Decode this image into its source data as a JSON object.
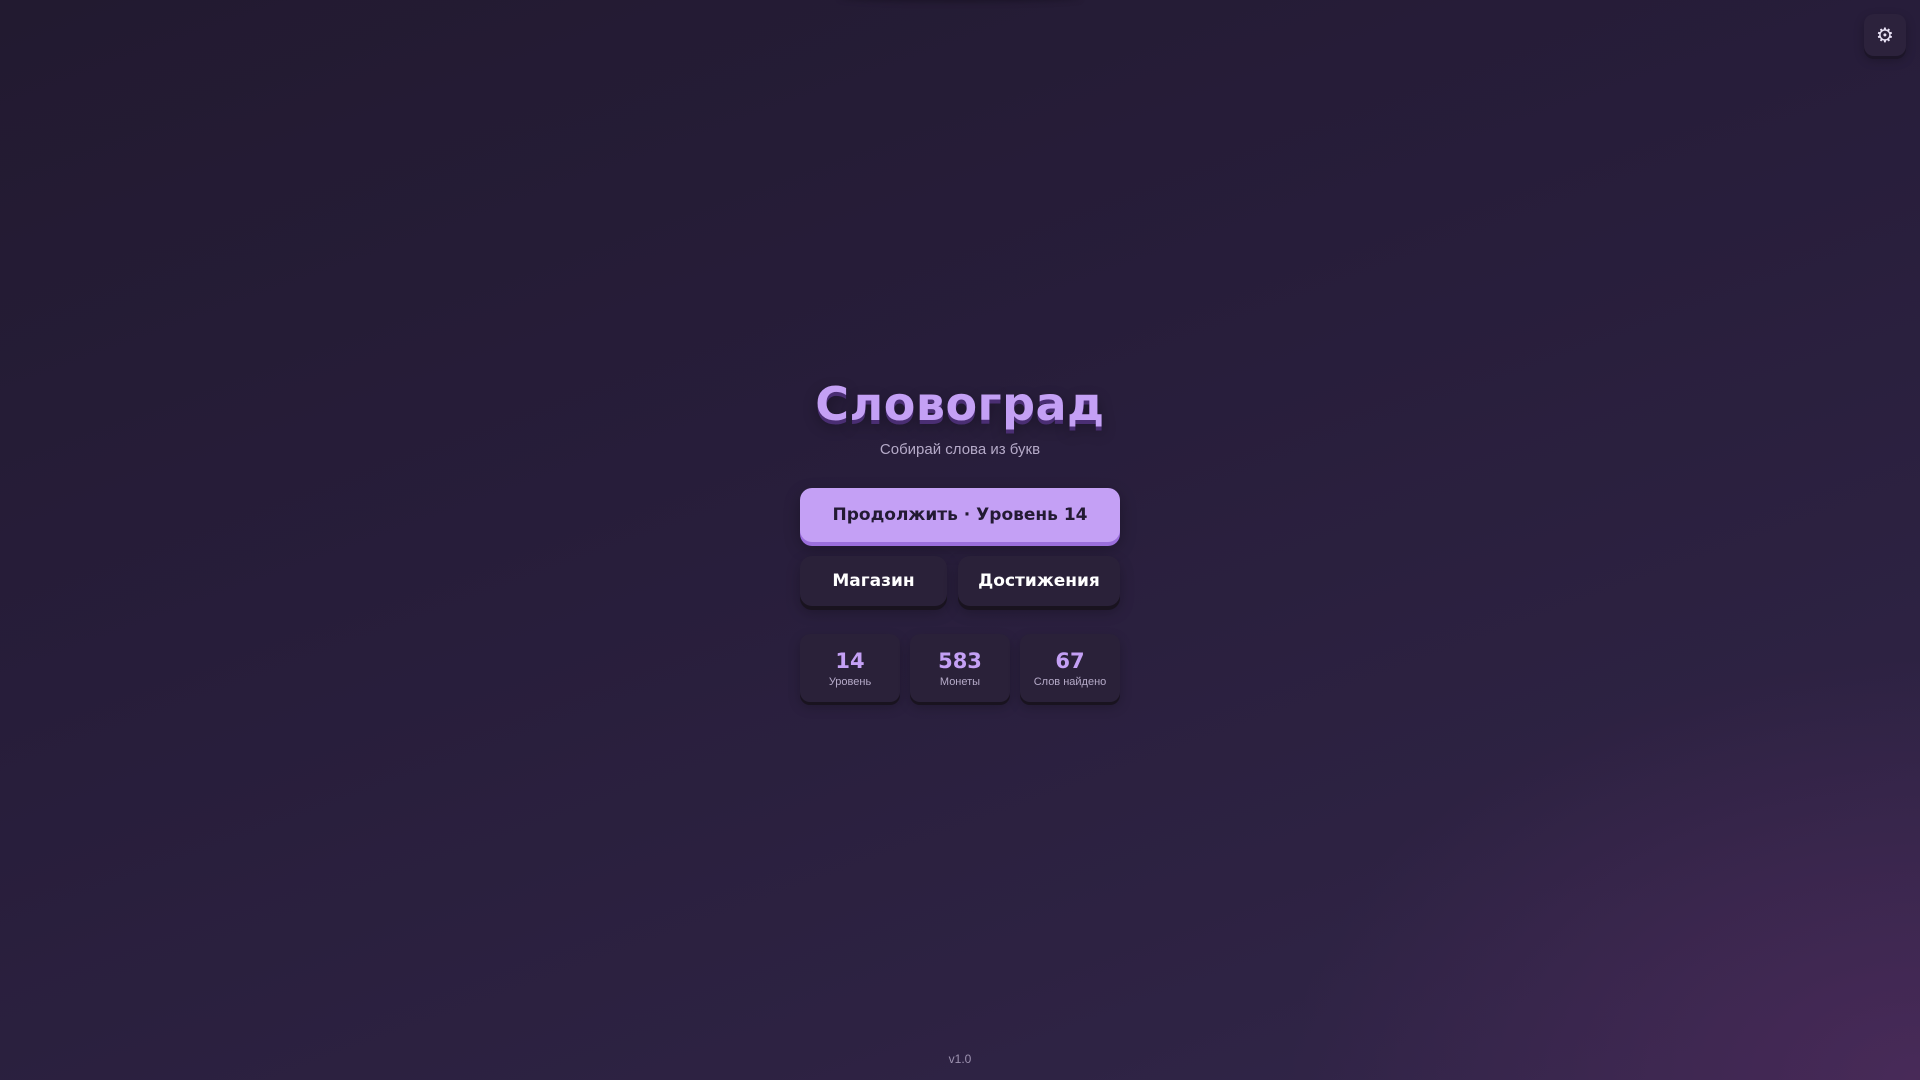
{
  "app": {
    "title": "Словоград",
    "subtitle": "Собирай слова из букв",
    "version": "v1.0"
  },
  "settings": {
    "icon": "gear-icon",
    "glyph": "⚙"
  },
  "menu": {
    "continue_label": "Продолжить · Уровень 14",
    "shop_label": "Магазин",
    "achievements_label": "Достижения"
  },
  "stats": [
    {
      "value": "14",
      "label": "Уровень"
    },
    {
      "value": "583",
      "label": "Монеты"
    },
    {
      "value": "67",
      "label": "Слов найдено"
    }
  ],
  "colors": {
    "accent": "#c4a0f5",
    "background": "#271d3a",
    "card": "#2a2139"
  }
}
